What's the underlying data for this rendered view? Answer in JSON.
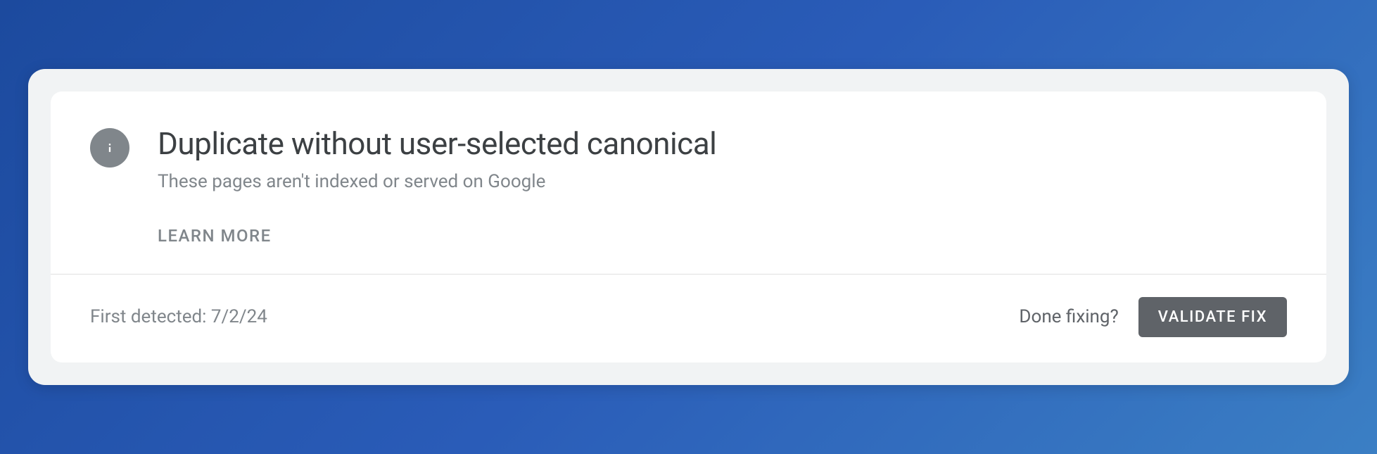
{
  "issue": {
    "title": "Duplicate without user-selected canonical",
    "subtitle": "These pages aren't indexed or served on Google",
    "learn_more_label": "LEARN MORE"
  },
  "footer": {
    "first_detected_label": "First detected: 7/2/24",
    "done_fixing_label": "Done fixing?",
    "validate_fix_label": "VALIDATE FIX"
  },
  "icons": {
    "info": "info-icon"
  }
}
